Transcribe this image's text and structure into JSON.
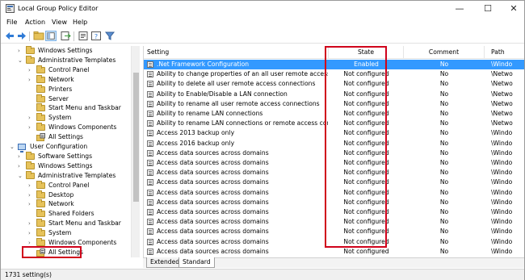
{
  "window": {
    "title": "Local Group Policy Editor",
    "minimize": "—",
    "maximize": "☐",
    "close": "✕"
  },
  "menu": [
    "File",
    "Action",
    "View",
    "Help"
  ],
  "toolbar": {
    "icons": [
      "back-icon",
      "forward-icon",
      "up-folder-icon",
      "show-hide-tree-icon",
      "export-list-icon",
      "properties-icon",
      "help-icon",
      "filter-icon"
    ]
  },
  "tree": [
    {
      "label": "Windows Settings",
      "indent": 2,
      "expander": "›",
      "icon": "folder"
    },
    {
      "label": "Administrative Templates",
      "indent": 2,
      "expander": "⌄",
      "icon": "folder"
    },
    {
      "label": "Control Panel",
      "indent": 3,
      "expander": "›",
      "icon": "folder"
    },
    {
      "label": "Network",
      "indent": 3,
      "expander": "›",
      "icon": "folder"
    },
    {
      "label": "Printers",
      "indent": 3,
      "expander": "",
      "icon": "folder"
    },
    {
      "label": "Server",
      "indent": 3,
      "expander": "",
      "icon": "folder"
    },
    {
      "label": "Start Menu and Taskbar",
      "indent": 3,
      "expander": "",
      "icon": "folder"
    },
    {
      "label": "System",
      "indent": 3,
      "expander": "›",
      "icon": "folder"
    },
    {
      "label": "Windows Components",
      "indent": 3,
      "expander": "›",
      "icon": "folder"
    },
    {
      "label": "All Settings",
      "indent": 3,
      "expander": "",
      "icon": "allsettings"
    },
    {
      "label": "User Configuration",
      "indent": 0,
      "expander": "⌄",
      "icon": "user"
    },
    {
      "label": "Software Settings",
      "indent": 2,
      "expander": "›",
      "icon": "folder"
    },
    {
      "label": "Windows Settings",
      "indent": 2,
      "expander": "›",
      "icon": "folder"
    },
    {
      "label": "Administrative Templates",
      "indent": 2,
      "expander": "⌄",
      "icon": "folder"
    },
    {
      "label": "Control Panel",
      "indent": 3,
      "expander": "›",
      "icon": "folder"
    },
    {
      "label": "Desktop",
      "indent": 3,
      "expander": "›",
      "icon": "folder"
    },
    {
      "label": "Network",
      "indent": 3,
      "expander": "›",
      "icon": "folder"
    },
    {
      "label": "Shared Folders",
      "indent": 3,
      "expander": "",
      "icon": "folder"
    },
    {
      "label": "Start Menu and Taskbar",
      "indent": 3,
      "expander": "›",
      "icon": "folder"
    },
    {
      "label": "System",
      "indent": 3,
      "expander": "›",
      "icon": "folder"
    },
    {
      "label": "Windows Components",
      "indent": 3,
      "expander": "›",
      "icon": "folder"
    },
    {
      "label": "All Settings",
      "indent": 3,
      "expander": "",
      "icon": "allsettings"
    }
  ],
  "columns": {
    "setting": "Setting",
    "state": "State",
    "comment": "Comment",
    "path": "Path"
  },
  "rows": [
    {
      "setting": ".Net Framework Configuration",
      "state": "Enabled",
      "comment": "No",
      "path": "\\Windo"
    },
    {
      "setting": "Ability to change properties of an all user remote access con...",
      "state": "Not configured",
      "comment": "No",
      "path": "\\Netwo"
    },
    {
      "setting": "Ability to delete all user remote access connections",
      "state": "Not configured",
      "comment": "No",
      "path": "\\Netwo"
    },
    {
      "setting": "Ability to Enable/Disable a LAN connection",
      "state": "Not configured",
      "comment": "No",
      "path": "\\Netwo"
    },
    {
      "setting": "Ability to rename all user remote access connections",
      "state": "Not configured",
      "comment": "No",
      "path": "\\Netwo"
    },
    {
      "setting": "Ability to rename LAN connections",
      "state": "Not configured",
      "comment": "No",
      "path": "\\Netwo"
    },
    {
      "setting": "Ability to rename LAN connections or remote access conne...",
      "state": "Not configured",
      "comment": "No",
      "path": "\\Netwo"
    },
    {
      "setting": "Access 2013 backup only",
      "state": "Not configured",
      "comment": "No",
      "path": "\\Windo"
    },
    {
      "setting": "Access 2016 backup only",
      "state": "Not configured",
      "comment": "No",
      "path": "\\Windo"
    },
    {
      "setting": "Access data sources across domains",
      "state": "Not configured",
      "comment": "No",
      "path": "\\Windo"
    },
    {
      "setting": "Access data sources across domains",
      "state": "Not configured",
      "comment": "No",
      "path": "\\Windo"
    },
    {
      "setting": "Access data sources across domains",
      "state": "Not configured",
      "comment": "No",
      "path": "\\Windo"
    },
    {
      "setting": "Access data sources across domains",
      "state": "Not configured",
      "comment": "No",
      "path": "\\Windo"
    },
    {
      "setting": "Access data sources across domains",
      "state": "Not configured",
      "comment": "No",
      "path": "\\Windo"
    },
    {
      "setting": "Access data sources across domains",
      "state": "Not configured",
      "comment": "No",
      "path": "\\Windo"
    },
    {
      "setting": "Access data sources across domains",
      "state": "Not configured",
      "comment": "No",
      "path": "\\Windo"
    },
    {
      "setting": "Access data sources across domains",
      "state": "Not configured",
      "comment": "No",
      "path": "\\Windo"
    },
    {
      "setting": "Access data sources across domains",
      "state": "Not configured",
      "comment": "No",
      "path": "\\Windo"
    },
    {
      "setting": "Access data sources across domains",
      "state": "Not configured",
      "comment": "No",
      "path": "\\Windo"
    },
    {
      "setting": "Access data sources across domains",
      "state": "Not configured",
      "comment": "No",
      "path": "\\Windo"
    }
  ],
  "tabs": [
    "Extended",
    "Standard"
  ],
  "status": "1731 setting(s)",
  "colors": {
    "selection": "#3399ff",
    "highlight": "#d0021b",
    "folder": "#e6c25a"
  }
}
